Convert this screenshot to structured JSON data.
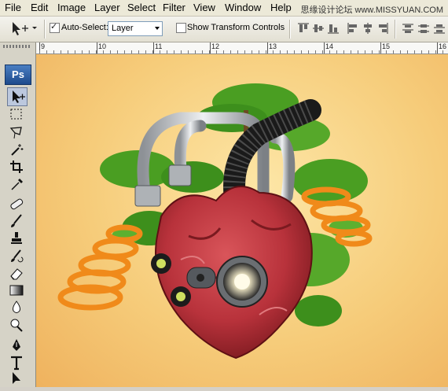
{
  "menu": [
    "File",
    "Edit",
    "Image",
    "Layer",
    "Select",
    "Filter",
    "View",
    "Window",
    "Help"
  ],
  "watermark": "思缘设计论坛 www.MISSYUAN.COM",
  "options": {
    "auto_select_label": "Auto-Select:",
    "auto_select_checked": true,
    "auto_select_value": "Layer",
    "show_transform_label": "Show Transform Controls",
    "show_transform_checked": false
  },
  "toolbox": {
    "logo": "Ps"
  },
  "ruler": {
    "labels": [
      "9",
      "10",
      "11",
      "12",
      "13",
      "14",
      "15",
      "16"
    ]
  },
  "colors": {
    "canvas_bg": "#f6cc7a",
    "heart": "#b8323b",
    "tree": "#3d8f1c",
    "spring": "#f08a1a",
    "pipe": "#c9ccd0"
  },
  "icons": {
    "tools": [
      "move-tool-icon",
      "marquee-tool-icon",
      "lasso-tool-icon",
      "magic-wand-icon",
      "crop-tool-icon",
      "eyedropper-icon",
      "healing-brush-icon",
      "brush-tool-icon",
      "clone-stamp-icon",
      "history-brush-icon",
      "eraser-icon",
      "gradient-tool-icon",
      "blur-tool-icon",
      "dodge-tool-icon",
      "pen-tool-icon",
      "type-tool-icon",
      "path-selection-icon"
    ]
  }
}
